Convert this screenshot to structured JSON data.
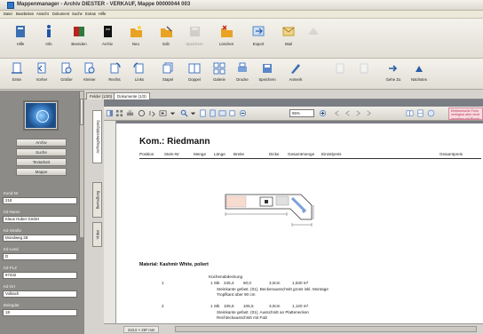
{
  "window": {
    "title": "Mappenmanager - Archiv DIESTER - VERKAUF, Mappe 00000044 003"
  },
  "menu": [
    "Datei",
    "Bearbeiten",
    "Ansicht",
    "Dokument",
    "Suche",
    "Extras",
    "Hilfe"
  ],
  "toolbar_main": [
    {
      "label": "Hilfe",
      "icon": "book-icon",
      "color": "#3a6fb3",
      "enabled": true
    },
    {
      "label": "Info",
      "icon": "info-icon",
      "color": "#1f56a8",
      "enabled": true
    },
    {
      "label": "Beenden",
      "icon": "exit-icon",
      "color": "#2c7a3e",
      "enabled": true
    },
    {
      "label": "Archiv",
      "icon": "archive-icon",
      "color": "#111111",
      "enabled": true
    },
    {
      "label": "Neu",
      "icon": "new-folder-icon",
      "color": "#e8a322",
      "enabled": true
    },
    {
      "label": "Edit",
      "icon": "edit-folder-icon",
      "color": "#e8a322",
      "enabled": true
    },
    {
      "label": "Speichern",
      "icon": "save-icon",
      "color": "#9a9a9a",
      "enabled": false
    },
    {
      "label": "Löschen",
      "icon": "delete-icon",
      "color": "#e8a322",
      "enabled": true
    },
    {
      "label": "Export",
      "icon": "export-icon",
      "color": "#4f88c8",
      "enabled": true
    },
    {
      "label": "Mail",
      "icon": "mail-icon",
      "color": "#c99a2a",
      "enabled": true
    },
    {
      "label": "",
      "icon": "scan-icon",
      "color": "#b0b0b0",
      "enabled": false
    }
  ],
  "toolbar_doc": [
    {
      "label": "Erste",
      "icon": "first-page-icon",
      "enabled": true
    },
    {
      "label": "Vorher",
      "icon": "previous-page-icon",
      "enabled": true
    },
    {
      "label": "Größer",
      "icon": "zoom-in-icon",
      "enabled": true
    },
    {
      "label": "Kleiner",
      "icon": "zoom-out-icon",
      "enabled": true
    },
    {
      "label": "Rechts",
      "icon": "rotate-right-icon",
      "enabled": true
    },
    {
      "label": "Links",
      "icon": "rotate-left-icon",
      "enabled": true
    },
    {
      "label": "Stapel",
      "icon": "stack-icon",
      "enabled": true
    },
    {
      "label": "Doppel",
      "icon": "double-page-icon",
      "enabled": true
    },
    {
      "label": "Galerie",
      "icon": "gallery-icon",
      "enabled": true
    },
    {
      "label": "Drucke",
      "icon": "print-icon",
      "enabled": true
    },
    {
      "label": "Speichern",
      "icon": "save-doc-icon",
      "enabled": true
    },
    {
      "label": "Anmerk",
      "icon": "annotation-icon",
      "enabled": true
    },
    {
      "label": "",
      "icon": "copy-icon",
      "enabled": false
    },
    {
      "label": "",
      "icon": "paste-icon",
      "enabled": false
    },
    {
      "label": "Gehe Zu",
      "icon": "goto-icon",
      "enabled": true
    },
    {
      "label": "Nächstes",
      "icon": "next-icon",
      "enabled": true
    }
  ],
  "sidebar": {
    "nav": [
      "Archiv",
      "Suche",
      "Textarbeit",
      "Mappe"
    ],
    "fields": [
      {
        "label": "Kund-Nr",
        "value": "218"
      },
      {
        "label": "Kd-Name",
        "value": "Klaus Huber GmbH"
      },
      {
        "label": "Kd-Straße",
        "value": "Mondweg 28"
      },
      {
        "label": "Kd-Land",
        "value": "D"
      },
      {
        "label": "Kd-PLZ",
        "value": "97332"
      },
      {
        "label": "Kd-Ort",
        "value": "Volkach"
      },
      {
        "label": "Belegdat",
        "value": "18"
      }
    ]
  },
  "tabs": [
    {
      "label": "Felder (1/20)",
      "active": false
    },
    {
      "label": "Dokumente (1/3)",
      "active": true
    }
  ],
  "side_tabs": [
    "Auftragsbestätigung",
    "Bemaßung",
    "Video"
  ],
  "viewer": {
    "zoom": "95%",
    "page_indicator": "1",
    "notice": "Elektronische Form verfügbar aber nicht ansehbar mit Plugin",
    "status": "210,0 × 297 mm"
  },
  "document": {
    "title": "Kom.: Riedmann",
    "columns": [
      "Position",
      "Stein-Nr",
      "Menge",
      "Länge",
      "Breite",
      "Dicke",
      "Gesamtmenge",
      "Einzelpreis",
      "Gesamtpreis"
    ],
    "material": "Material: Kashmir White, poliert",
    "section": "Küchenabdeckung",
    "rows": [
      {
        "pos": "1",
        "qty": "1 Stk",
        "length": "245,4",
        "width": "60,0",
        "thickness": "3,0cm",
        "total": "1,530 m²",
        "notes": [
          "Steinkante gefast. (01). Beckenausschnitt gross inkl. Montage",
          "Tropfkant über 90 cm"
        ]
      },
      {
        "pos": "2",
        "qty": "1 Stk",
        "length": "105,5",
        "width": "105,5",
        "thickness": "3,0cm",
        "total": "1,120 m²",
        "notes": [
          "Steinkante gefast. (01). Ausschnitt an Plattenecken",
          "Rechteckausschnitt mit Falz"
        ]
      }
    ]
  }
}
